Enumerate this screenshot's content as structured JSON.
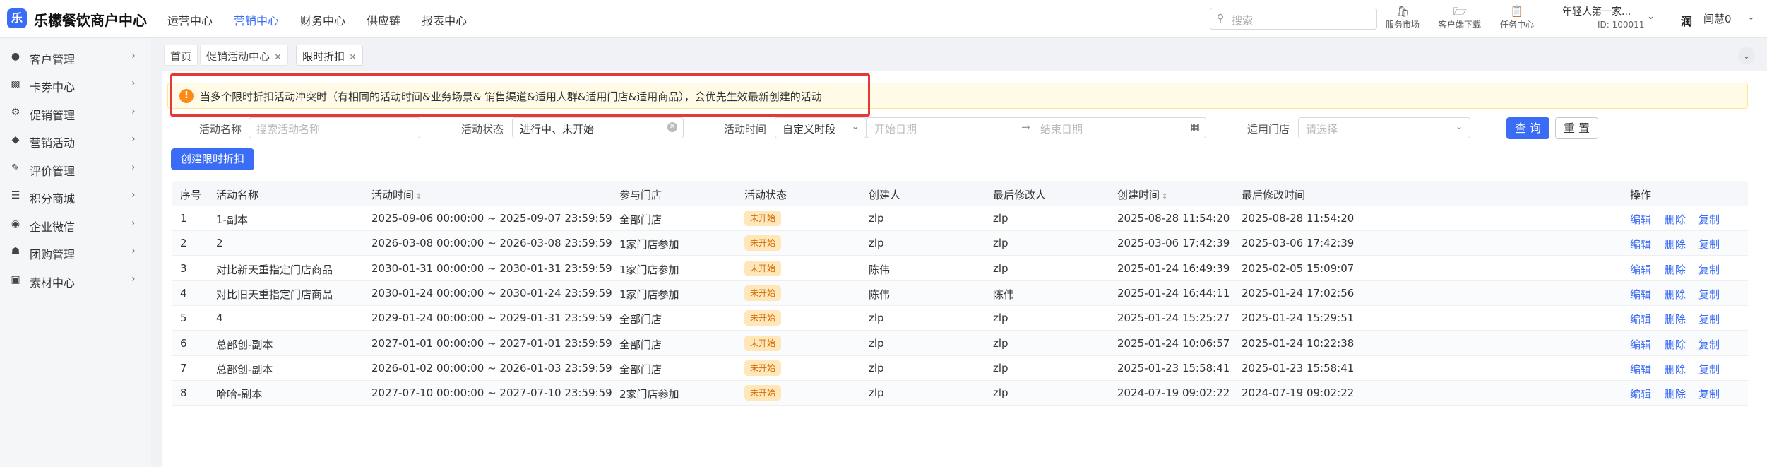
{
  "app": {
    "logo_glyph": "乐",
    "name": "乐檬餐饮商户中心",
    "brand_color": "#3b6cf6"
  },
  "top_nav": [
    {
      "label": "运营中心",
      "active": false
    },
    {
      "label": "营销中心",
      "active": true
    },
    {
      "label": "财务中心",
      "active": false
    },
    {
      "label": "供应链",
      "active": false
    },
    {
      "label": "报表中心",
      "active": false
    }
  ],
  "search": {
    "placeholder": "搜索",
    "icon": "search-icon"
  },
  "tools": [
    {
      "label": "服务市场",
      "icon": "shop-bag-icon"
    },
    {
      "label": "客户端下载",
      "icon": "download-folder-icon"
    },
    {
      "label": "任务中心",
      "icon": "clipboard-icon"
    }
  ],
  "account": {
    "name": "年轻人第一家...",
    "id": "ID: 100011"
  },
  "user": {
    "avatar": "润",
    "name": "闫慧0"
  },
  "sidebar": [
    {
      "label": "客户管理",
      "icon": "user-icon"
    },
    {
      "label": "卡劵中心",
      "icon": "card-icon"
    },
    {
      "label": "促销管理",
      "icon": "gear-icon"
    },
    {
      "label": "营销活动",
      "icon": "tag-icon"
    },
    {
      "label": "评价管理",
      "icon": "edit-check-icon"
    },
    {
      "label": "积分商城",
      "icon": "database-icon"
    },
    {
      "label": "企业微信",
      "icon": "chat-icon"
    },
    {
      "label": "团购管理",
      "icon": "store-icon"
    },
    {
      "label": "素材中心",
      "icon": "image-icon"
    }
  ],
  "tabs": [
    {
      "label": "首页",
      "closable": false,
      "active": false
    },
    {
      "label": "促销活动中心",
      "closable": true,
      "active": false
    },
    {
      "label": "限时折扣",
      "closable": true,
      "active": true
    }
  ],
  "alert": {
    "text": "当多个限时折扣活动冲突时（有相同的活动时间&业务场景& 销售渠道&适用人群&适用门店&适用商品），会优先生效最新创建的活动",
    "icon": "warning-icon"
  },
  "filters": {
    "name_label": "活动名称",
    "name_placeholder": "搜索活动名称",
    "status_label": "活动状态",
    "status_value": "进行中、未开始",
    "time_label": "活动时间",
    "time_mode": "自定义时段",
    "start_placeholder": "开始日期",
    "range_arrow": "→",
    "end_placeholder": "结束日期",
    "store_label": "适用门店",
    "store_placeholder": "请选择",
    "query_label": "查 询",
    "reset_label": "重 置"
  },
  "create_label": "创建限时折扣",
  "table": {
    "headers": [
      "序号",
      "活动名称",
      "活动时间",
      "参与门店",
      "活动状态",
      "创建人",
      "最后修改人",
      "创建时间",
      "最后修改时间",
      "操作"
    ],
    "ops": [
      "编辑",
      "删除",
      "复制"
    ],
    "rows": [
      {
        "no": "1",
        "name": "1-副本",
        "time": "2025-09-06 00:00:00 ~ 2025-09-07 23:59:59",
        "store": "全部门店",
        "status": "未开始",
        "creator": "zlp",
        "modifier": "zlp",
        "created": "2025-08-28 11:54:20",
        "modified": "2025-08-28 11:54:20"
      },
      {
        "no": "2",
        "name": "2",
        "time": "2026-03-08 00:00:00 ~ 2026-03-08 23:59:59",
        "store": "1家门店参加",
        "status": "未开始",
        "creator": "zlp",
        "modifier": "zlp",
        "created": "2025-03-06 17:42:39",
        "modified": "2025-03-06 17:42:39"
      },
      {
        "no": "3",
        "name": "对比新天重指定门店商品",
        "time": "2030-01-31 00:00:00 ~ 2030-01-31 23:59:59",
        "store": "1家门店参加",
        "status": "未开始",
        "creator": "陈伟",
        "modifier": "zlp",
        "created": "2025-01-24 16:49:39",
        "modified": "2025-02-05 15:09:07"
      },
      {
        "no": "4",
        "name": "对比旧天重指定门店商品",
        "time": "2030-01-24 00:00:00 ~ 2030-01-24 23:59:59",
        "store": "1家门店参加",
        "status": "未开始",
        "creator": "陈伟",
        "modifier": "陈伟",
        "created": "2025-01-24 16:44:11",
        "modified": "2025-01-24 17:02:56"
      },
      {
        "no": "5",
        "name": "4",
        "time": "2029-01-24 00:00:00 ~ 2029-01-31 23:59:59",
        "store": "全部门店",
        "status": "未开始",
        "creator": "zlp",
        "modifier": "zlp",
        "created": "2025-01-24 15:25:27",
        "modified": "2025-01-24 15:29:51"
      },
      {
        "no": "6",
        "name": "总部创-副本",
        "time": "2027-01-01 00:00:00 ~ 2027-01-01 23:59:59",
        "store": "全部门店",
        "status": "未开始",
        "creator": "zlp",
        "modifier": "zlp",
        "created": "2025-01-24 10:06:57",
        "modified": "2025-01-24 10:22:38"
      },
      {
        "no": "7",
        "name": "总部创-副本",
        "time": "2026-01-02 00:00:00 ~ 2026-01-03 23:59:59",
        "store": "全部门店",
        "status": "未开始",
        "creator": "zlp",
        "modifier": "zlp",
        "created": "2025-01-23 15:58:41",
        "modified": "2025-01-23 15:58:41"
      },
      {
        "no": "8",
        "name": "哈哈-副本",
        "time": "2027-07-10 00:00:00 ~ 2027-07-10 23:59:59",
        "store": "2家门店参加",
        "status": "未开始",
        "creator": "zlp",
        "modifier": "zlp",
        "created": "2024-07-19 09:02:22",
        "modified": "2024-07-19 09:02:22"
      }
    ]
  }
}
